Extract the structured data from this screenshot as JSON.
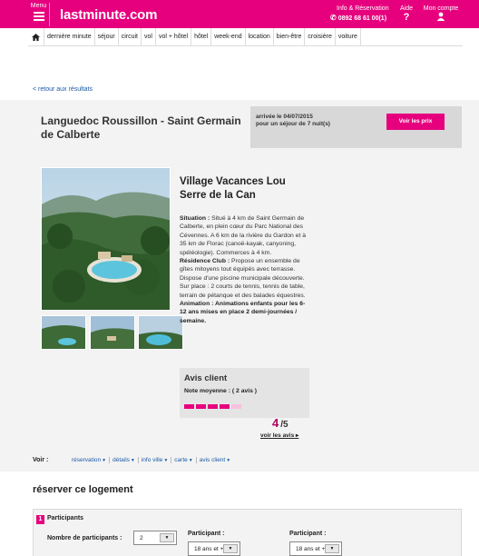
{
  "header": {
    "menu_label": "Menu",
    "logo": "lastminute.com",
    "info_label": "Info & Réservation",
    "phone": "0892 68 61 00(1)",
    "aide_label": "Aide",
    "aide_glyph": "?",
    "compte_label": "Mon compte"
  },
  "nav": {
    "items": [
      "dernière minute",
      "séjour",
      "circuit",
      "vol",
      "vol + hôtel",
      "hôtel",
      "week-end",
      "location",
      "bien-être",
      "croisière",
      "voiture"
    ]
  },
  "back_link": "< retour aux résultats",
  "hotel": {
    "region_title": "Languedoc Roussillon - Saint Germain de Calberte",
    "arrival_line1": "arrivée le 04/07/2015",
    "arrival_line2": "pour un séjour de 7 nuit(s)",
    "prices_button": "Voir les prix",
    "name": "Village Vacances Lou Serre de la Can",
    "situation_label": "Situation :",
    "situation_text": " Situé à 4 km de Saint Germain de Calberte, en plein cœur du Parc National des Cévennes. A 6 km de la rivière du Gardon et à 35 km de Florac (canoë-kayak, canyoning, spéléologie). Commerces à 4 km.",
    "residence_label": "Résidence Club :",
    "residence_text": " Propose un ensemble de gîtes mitoyens tout équipés avec terrasse. Dispose d'une piscine municipale découverte. Sur place : 2 courts de tennis, tennis de table, terrain de pétanque et des balades équestres.",
    "animation_label": "Animation :",
    "animation_text": " Animations enfants pour les 6-12 ans mises en place 2 demi-journées / semaine."
  },
  "avis": {
    "title": "Avis client",
    "note_label": "Note moyenne : ( 2 avis )",
    "score": "4",
    "score_out": "/5",
    "rating_fraction": 0.8,
    "see_all": "voir les avis"
  },
  "voir": {
    "label": "Voir :",
    "links": [
      "réservation",
      "détails",
      "info ville",
      "carte",
      "avis client"
    ]
  },
  "reserve": {
    "title": "réserver ce logement",
    "step_number": "1",
    "step_label": "Participants",
    "nb_label": "Nombre de participants :",
    "nb_value": "2",
    "participant1_label": "Participant :",
    "participant1_value": "18 ans et +",
    "participant2_label": "Participant :",
    "participant2_value": "18 ans et +"
  },
  "colors": {
    "brand": "#e6007e",
    "link": "#1a5aa6"
  }
}
